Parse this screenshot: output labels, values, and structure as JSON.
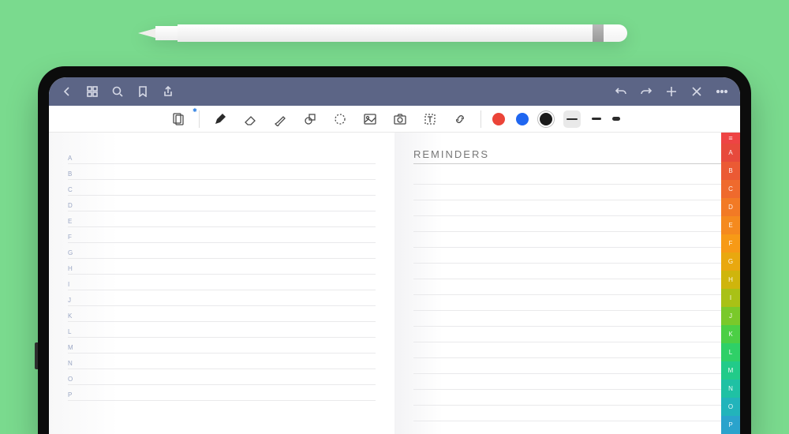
{
  "topbar": {
    "icons": [
      "back",
      "grid",
      "search",
      "bookmark",
      "share",
      "undo",
      "redo",
      "add",
      "close",
      "more"
    ]
  },
  "toolbar": {
    "tools": [
      "pages",
      "pen",
      "eraser",
      "highlighter",
      "shapes",
      "lasso",
      "image",
      "camera",
      "text",
      "link"
    ],
    "colors": {
      "red": "#eb4438",
      "blue": "#1f66f0",
      "black": "#1b1b1b"
    },
    "selected_color": "black",
    "selected_size": 1,
    "bluetooth_badge": "✱"
  },
  "left_page": {
    "letters": [
      "A",
      "B",
      "C",
      "D",
      "E",
      "F",
      "G",
      "H",
      "I",
      "J",
      "K",
      "L",
      "M",
      "N",
      "O",
      "P"
    ]
  },
  "right_page": {
    "heading": "REMINDERS",
    "line_count": 17
  },
  "index_tabs": {
    "menu_glyph": "≡",
    "labels": [
      "A",
      "B",
      "C",
      "D",
      "E",
      "F",
      "G",
      "H",
      "I",
      "J",
      "K",
      "L",
      "M",
      "N",
      "O",
      "P"
    ],
    "colors": [
      "#e74a3c",
      "#eb5a34",
      "#ef6a2d",
      "#f27a25",
      "#f58a1e",
      "#f79a16",
      "#e9a80f",
      "#cfb50c",
      "#a9c116",
      "#7ac92a",
      "#4ccf45",
      "#2fd067",
      "#22cb89",
      "#1fc1a4",
      "#22b4bb",
      "#2aa3cc"
    ]
  }
}
